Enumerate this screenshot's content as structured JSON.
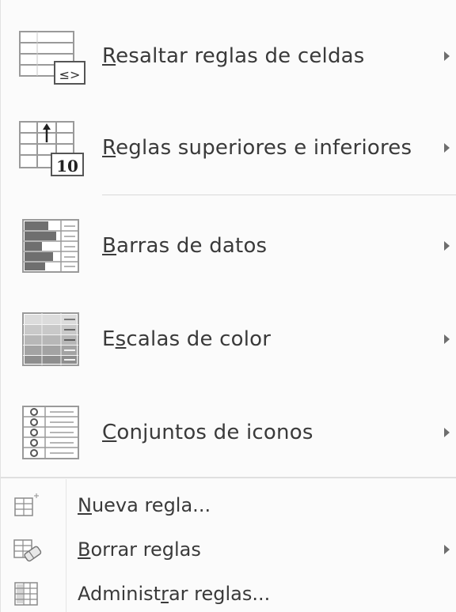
{
  "menu": {
    "items": [
      {
        "label": "Resaltar reglas de celdas",
        "access_key": "R",
        "icon": "highlight-cells-rules-icon",
        "submenu": true
      },
      {
        "label": "Reglas superiores e inferiores",
        "access_key": "R",
        "icon": "top-bottom-rules-icon",
        "submenu": true
      },
      {
        "label": "Barras de datos",
        "access_key": "B",
        "icon": "data-bars-icon",
        "submenu": true
      },
      {
        "label": "Escalas de color",
        "access_key": "s",
        "icon": "color-scales-icon",
        "submenu": true
      },
      {
        "label": "Conjuntos de iconos",
        "access_key": "C",
        "icon": "icon-sets-icon",
        "submenu": true
      },
      {
        "label": "Nueva regla...",
        "access_key": "N",
        "icon": "new-rule-icon",
        "submenu": false
      },
      {
        "label": "Borrar reglas",
        "access_key": "B",
        "icon": "clear-rules-icon",
        "submenu": true
      },
      {
        "label": "Administrar reglas...",
        "access_key": "r",
        "icon": "manage-rules-icon",
        "submenu": false
      }
    ],
    "icon_text": {
      "highlight": "≤>",
      "top_bottom": "10"
    }
  },
  "colors": {
    "text": "#3a3a3a",
    "icon_gray": "#8a8a8a",
    "bar_dark": "#6f6f6f",
    "separator": "#d9d9d9"
  }
}
